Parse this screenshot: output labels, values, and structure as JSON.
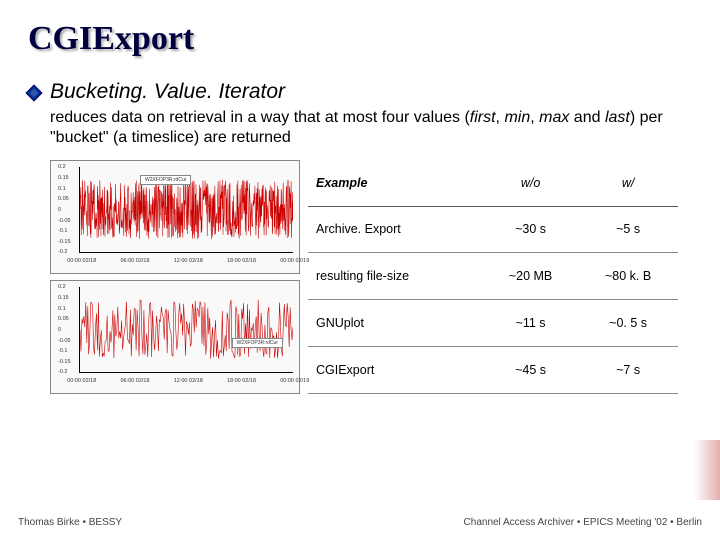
{
  "title": "CGIExport",
  "bullet": "Bucketing. Value. Iterator",
  "explain_pre": "reduces data on retrieval in a way that at most four values (",
  "explain_first": "first",
  "explain_mid1": ", ",
  "explain_min": "min",
  "explain_mid2": ", ",
  "explain_max": "max",
  "explain_mid3": " and ",
  "explain_last": "last",
  "explain_post": ") per \"bucket\" (a timeslice) are returned",
  "table": {
    "headers": [
      "Example",
      "w/o",
      "w/"
    ],
    "rows": [
      [
        "Archive. Export",
        "~30 s",
        "~5 s"
      ],
      [
        "resulting file-size",
        "~20 MB",
        "~80 k. B"
      ],
      [
        "GNUplot",
        "~11 s",
        "~0. 5 s"
      ],
      [
        "CGIExport",
        "~45 s",
        "~7 s"
      ]
    ]
  },
  "footer_left": "Thomas Birke • BESSY",
  "footer_right": "Channel Access Archiver • EPICS Meeting '02 • Berlin",
  "chart_data": [
    {
      "type": "line",
      "title": "",
      "legend": [
        "W2XFOP3R:rdCur"
      ],
      "xlabel": "",
      "ylabel": "",
      "x_ticks": [
        "00:00 02/18",
        "06:00 02/18",
        "12:00 02/18",
        "18:00 02/18",
        "00:00 02/19"
      ],
      "y_ticks": [
        -0.2,
        -0.15,
        -0.1,
        -0.05,
        0,
        0.05,
        0.1,
        0.15,
        0.2
      ],
      "ylim": [
        -0.2,
        0.2
      ],
      "note": "dense noisy signal oscillating roughly between -0.15 and 0.15 across full day"
    },
    {
      "type": "line",
      "title": "",
      "legend": [
        "W2XFOP3R:rdCur"
      ],
      "xlabel": "",
      "ylabel": "",
      "x_ticks": [
        "00:00 02/18",
        "06:00 02/18",
        "12:00 02/18",
        "18:00 02/18",
        "00:00 02/19"
      ],
      "y_ticks": [
        -0.2,
        -0.15,
        -0.1,
        -0.05,
        0,
        0.05,
        0.1,
        0.15,
        0.2
      ],
      "ylim": [
        -0.2,
        0.2
      ],
      "note": "same signal after bucketing — visually near-identical envelope"
    }
  ]
}
